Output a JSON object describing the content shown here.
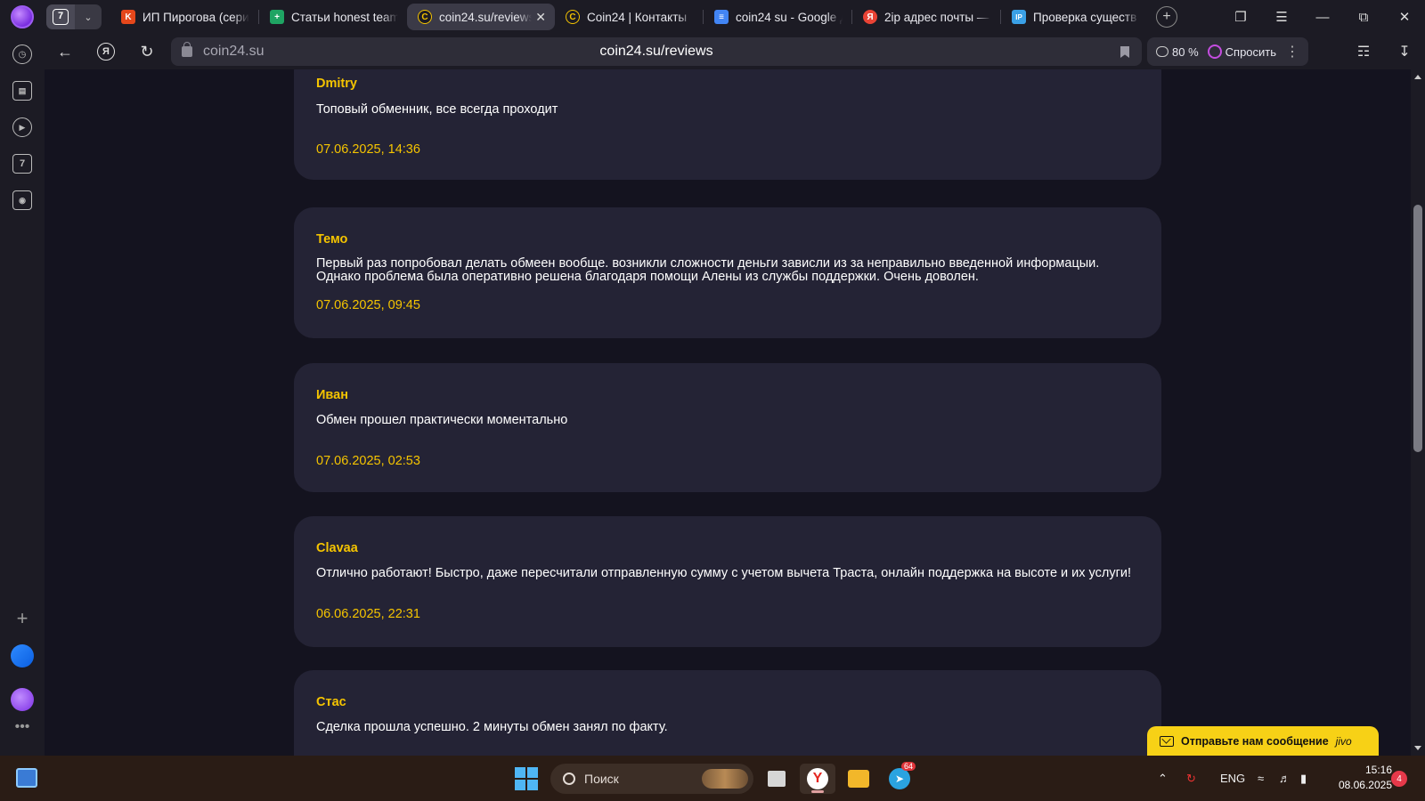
{
  "browser": {
    "tab_count": "7",
    "tabs": [
      {
        "label": "ИП Пирогова (сери",
        "favicon": "K",
        "favicon_color": "#e5471b"
      },
      {
        "label": "Статьи honest team",
        "favicon": "+",
        "favicon_color": "#1fa463"
      },
      {
        "label": "coin24.su/reviews",
        "favicon": "C",
        "favicon_color": "#3b3a47",
        "active": true
      },
      {
        "label": "Coin24 | Контакты",
        "favicon": "C",
        "favicon_color": "#1c1b24"
      },
      {
        "label": "coin24 su - Google Д",
        "favicon": "≡",
        "favicon_color": "#4285f4"
      },
      {
        "label": "2ip адрес почты —",
        "favicon": "Я",
        "favicon_color": "#e94335"
      },
      {
        "label": "Проверка существ",
        "favicon": "IP",
        "favicon_color": "#3aa0e6"
      }
    ],
    "address": {
      "host": "coin24.su",
      "url": "coin24.su/reviews"
    },
    "zoom": "80 %",
    "ask_label": "Спросить",
    "yandex_letter": "Я",
    "sidebar_box_label": "7"
  },
  "reviews": [
    {
      "author": "Dmitry",
      "text": "Топовый обменник, все всегда проходит",
      "date": "07.06.2025, 14:36"
    },
    {
      "author": "Темо",
      "text": "Первый раз попробовал делать обмеен вообще. возникли сложности деньги зависли из за неправильно введенной информацыи. Однако проблема была оперативно решена благодаря помощи Алены из службы поддержки. Очень доволен.",
      "date": "07.06.2025, 09:45"
    },
    {
      "author": "Иван",
      "text": "Обмен прошел практически моментально",
      "date": "07.06.2025, 02:53"
    },
    {
      "author": "Clavaa",
      "text": "Отлично работают! Быстро, даже пересчитали отправленную сумму с учетом вычета Траста, онлайн поддержка на высоте и их услуги!",
      "date": "06.06.2025, 22:31"
    },
    {
      "author": "Стас",
      "text": "Сделка прошла успешно. 2 минуты обмен занял по факту.",
      "date": ""
    }
  ],
  "chat_widget": {
    "label": "Отправьте нам сообщение",
    "brand": "jivo"
  },
  "taskbar": {
    "search_placeholder": "Поиск",
    "telegram_badge": "64",
    "language": "ENG",
    "time": "15:16",
    "date": "08.06.2025",
    "notifications": "4"
  },
  "colors": {
    "accent_yellow": "#f5c400",
    "card_bg": "#242335",
    "page_bg": "#14131f"
  }
}
